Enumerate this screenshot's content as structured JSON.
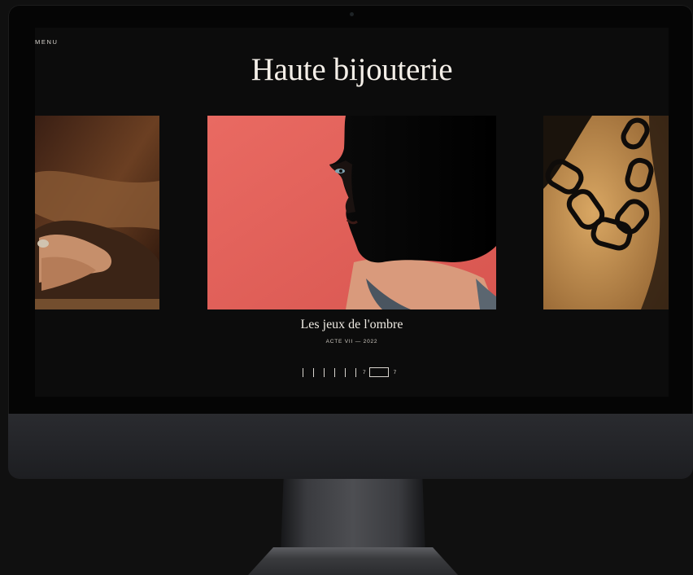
{
  "screen": {
    "menu_label": "MENU",
    "title": "Haute bijouterie",
    "slides": [
      {
        "name": "hands",
        "position": "left"
      },
      {
        "name": "woman-profile-necklace",
        "position": "center"
      },
      {
        "name": "chain-necklace",
        "position": "right"
      }
    ],
    "caption": {
      "title": "Les jeux de l'ombre",
      "subtitle": "ACTE VII — 2022"
    },
    "pager": {
      "current": "7",
      "total": "7",
      "tick_count": 6
    }
  },
  "colors": {
    "background": "#0c0c0c",
    "text": "#f3eee6",
    "center_image_bg": "#e3635d",
    "right_image_bg": "#c4914f"
  }
}
